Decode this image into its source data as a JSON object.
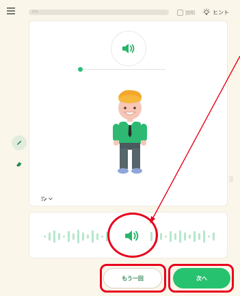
{
  "header": {
    "progress_label": "0%",
    "progress_fraction": 0.0,
    "explain_label": "説明",
    "hint_label": "ヒント"
  },
  "audio_player": {
    "slider_fraction": 0.0
  },
  "buttons": {
    "retry_label": "もう一回",
    "next_label": "次へ"
  },
  "icons": {
    "menu": "menu-icon",
    "hint": "lightbulb-icon",
    "explain": "square-icon",
    "speaker": "speaker-icon",
    "pencil": "pencil-icon",
    "eraser": "eraser-icon",
    "edit_dropdown": "edit-menu-icon"
  },
  "colors": {
    "accent": "#27c26f",
    "background": "#fbf6ea",
    "annotation": "#e8001c"
  }
}
